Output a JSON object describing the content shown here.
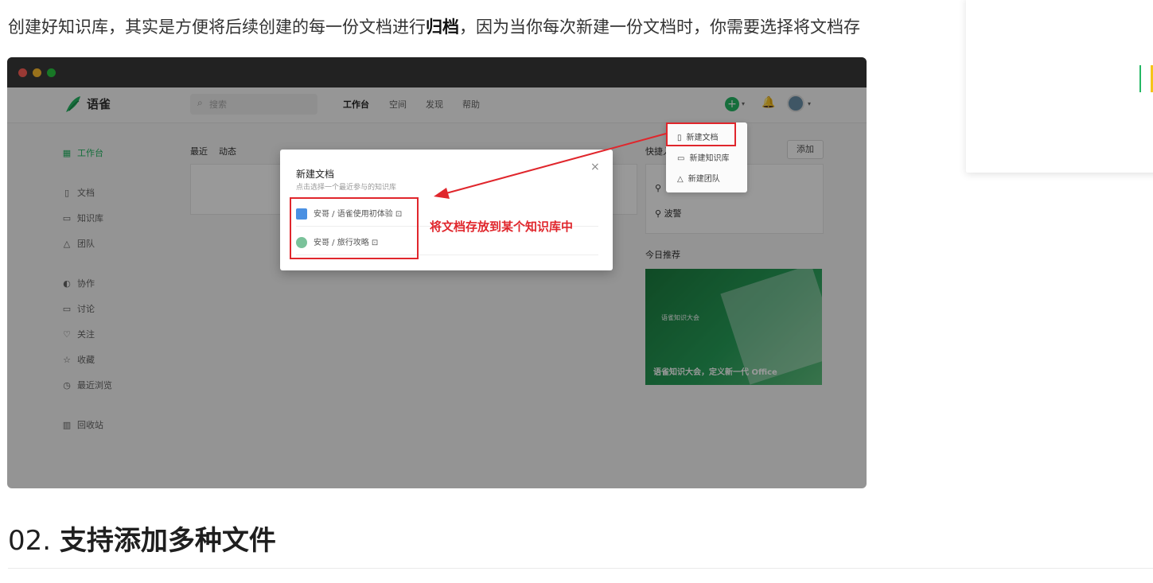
{
  "article": {
    "intro_before": "创建好知识库，其实是方便将后续创建的每一份文档进行",
    "intro_bold": "归档",
    "intro_after": "，因为当你每次新建一份文档时，你需要选择将文档存",
    "section_number": "02.",
    "section_title": "支持添加多种文件"
  },
  "screenshot": {
    "app": {
      "brand": "语雀",
      "search_placeholder": "搜索",
      "nav": [
        "工作台",
        "空间",
        "发现",
        "帮助"
      ],
      "sidebar": [
        {
          "icon": "grid-icon",
          "label": "工作台"
        },
        {
          "icon": "doc-icon",
          "label": "文档"
        },
        {
          "icon": "book-icon",
          "label": "知识库"
        },
        {
          "icon": "team-icon",
          "label": "团队"
        },
        {
          "icon": "collab-icon",
          "label": "协作"
        },
        {
          "icon": "comment-icon",
          "label": "讨论"
        },
        {
          "icon": "heart-icon",
          "label": "关注"
        },
        {
          "icon": "star-icon",
          "label": "收藏"
        },
        {
          "icon": "clock-icon",
          "label": "最近浏览"
        },
        {
          "icon": "trash-icon",
          "label": "回收站"
        }
      ],
      "tabs": [
        "最近",
        "动态"
      ],
      "quick_header": "快捷入口",
      "add_label": "添加",
      "quick_links": [
        "",
        "波警"
      ],
      "recommend_label": "今日推荐",
      "banner_caption": "语雀知识大会，定义新一代 Office",
      "banner_title": "语雀知识大会"
    },
    "dropdown": {
      "items": [
        "新建文档",
        "新建知识库",
        "新建团队"
      ]
    },
    "modal": {
      "title": "新建文档",
      "subtitle": "点击选择一个最近参与的知识库",
      "close": "×",
      "repos": [
        "安哥 / 语雀使用初体验",
        "安哥 / 旅行攻略"
      ],
      "annotation": "将文档存放到某个知识库中"
    }
  },
  "colors": {
    "accent_green": "#25b864",
    "highlight_red": "#e0262c"
  }
}
